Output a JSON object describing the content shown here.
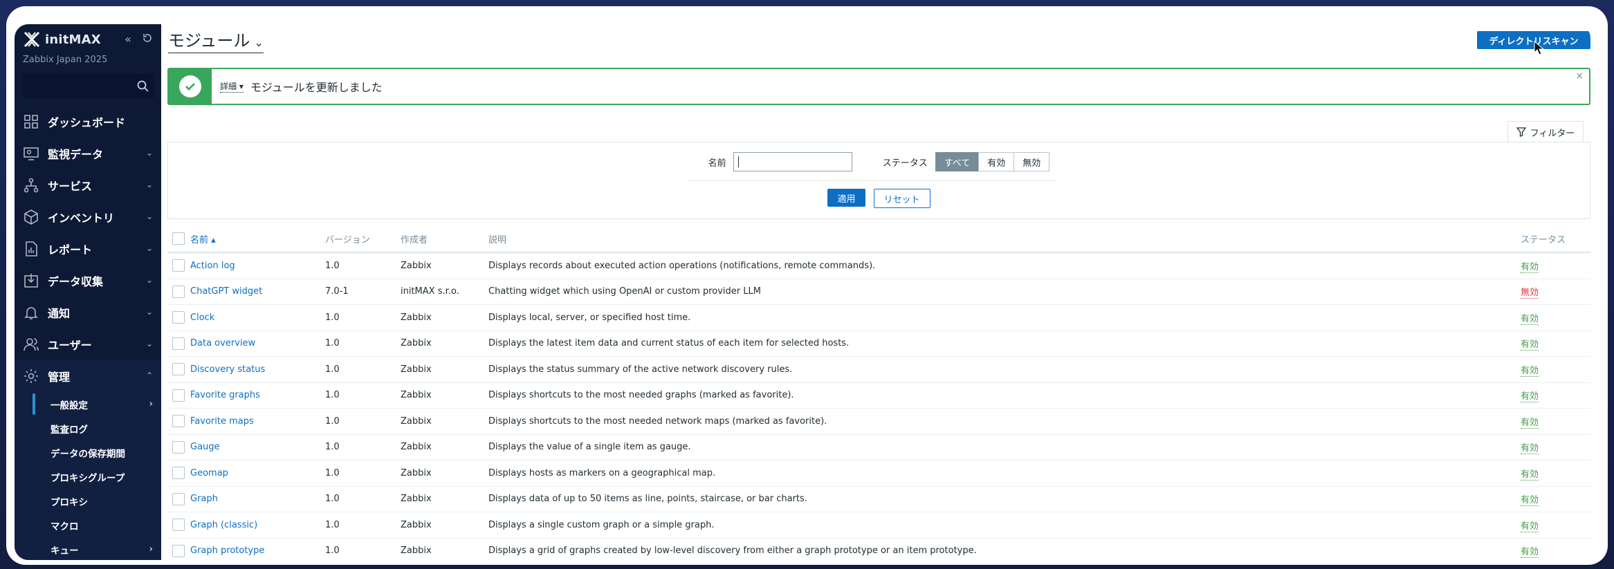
{
  "sidebar": {
    "brand": "initMAX",
    "subtitle": "Zabbix Japan 2025",
    "collapse_icon": "double-chevron-left-icon",
    "kiosk_icon": "refresh-icon",
    "search_icon": "search-icon",
    "nav": [
      {
        "label": "ダッシュボード",
        "icon": "dashboard-icon"
      },
      {
        "label": "監視データ",
        "icon": "monitoring-icon"
      },
      {
        "label": "サービス",
        "icon": "services-icon"
      },
      {
        "label": "インベントリ",
        "icon": "inventory-icon"
      },
      {
        "label": "レポート",
        "icon": "reports-icon"
      },
      {
        "label": "データ収集",
        "icon": "data-collection-icon"
      },
      {
        "label": "通知",
        "icon": "bell-icon"
      },
      {
        "label": "ユーザー",
        "icon": "users-icon"
      },
      {
        "label": "管理",
        "icon": "gear-icon"
      }
    ],
    "admin_sub": [
      "一般設定",
      "監査ログ",
      "データの保存期間",
      "プロキシグループ",
      "プロキシ",
      "マクロ",
      "キュー"
    ]
  },
  "header": {
    "title": "モジュール",
    "scan_button": "ディレクトリスキャン"
  },
  "message": {
    "details": "詳細 ▾",
    "text": "モジュールを更新しました",
    "close": "×"
  },
  "filter": {
    "tab_label": "フィルター",
    "name_label": "名前",
    "name_value": "",
    "status_label": "ステータス",
    "status_options": [
      "すべて",
      "有効",
      "無効"
    ],
    "selected_status": "すべて",
    "apply": "適用",
    "reset": "リセット"
  },
  "table": {
    "columns": {
      "name": "名前 ▴",
      "version": "バージョン",
      "author": "作成者",
      "description": "説明",
      "status": "ステータス"
    },
    "rows": [
      {
        "name": "Action log",
        "version": "1.0",
        "author": "Zabbix",
        "description": "Displays records about executed action operations (notifications, remote commands).",
        "status": "有効",
        "enabled": true
      },
      {
        "name": "ChatGPT widget",
        "version": "7.0-1",
        "author": "initMAX s.r.o.",
        "description": "Chatting widget which using OpenAI or custom provider LLM",
        "status": "無効",
        "enabled": false
      },
      {
        "name": "Clock",
        "version": "1.0",
        "author": "Zabbix",
        "description": "Displays local, server, or specified host time.",
        "status": "有効",
        "enabled": true
      },
      {
        "name": "Data overview",
        "version": "1.0",
        "author": "Zabbix",
        "description": "Displays the latest item data and current status of each item for selected hosts.",
        "status": "有効",
        "enabled": true
      },
      {
        "name": "Discovery status",
        "version": "1.0",
        "author": "Zabbix",
        "description": "Displays the status summary of the active network discovery rules.",
        "status": "有効",
        "enabled": true
      },
      {
        "name": "Favorite graphs",
        "version": "1.0",
        "author": "Zabbix",
        "description": "Displays shortcuts to the most needed graphs (marked as favorite).",
        "status": "有効",
        "enabled": true
      },
      {
        "name": "Favorite maps",
        "version": "1.0",
        "author": "Zabbix",
        "description": "Displays shortcuts to the most needed network maps (marked as favorite).",
        "status": "有効",
        "enabled": true
      },
      {
        "name": "Gauge",
        "version": "1.0",
        "author": "Zabbix",
        "description": "Displays the value of a single item as gauge.",
        "status": "有効",
        "enabled": true
      },
      {
        "name": "Geomap",
        "version": "1.0",
        "author": "Zabbix",
        "description": "Displays hosts as markers on a geographical map.",
        "status": "有効",
        "enabled": true
      },
      {
        "name": "Graph",
        "version": "1.0",
        "author": "Zabbix",
        "description": "Displays data of up to 50 items as line, points, staircase, or bar charts.",
        "status": "有効",
        "enabled": true
      },
      {
        "name": "Graph (classic)",
        "version": "1.0",
        "author": "Zabbix",
        "description": "Displays a single custom graph or a simple graph.",
        "status": "有効",
        "enabled": true
      },
      {
        "name": "Graph prototype",
        "version": "1.0",
        "author": "Zabbix",
        "description": "Displays a grid of graphs created by low-level discovery from either a graph prototype or an item prototype.",
        "status": "有効",
        "enabled": true
      }
    ]
  },
  "colors": {
    "sidebar_bg": "#0e1a35",
    "primary": "#0c6fc4",
    "success": "#39a75b",
    "enabled": "#429e47",
    "disabled": "#e33734"
  }
}
